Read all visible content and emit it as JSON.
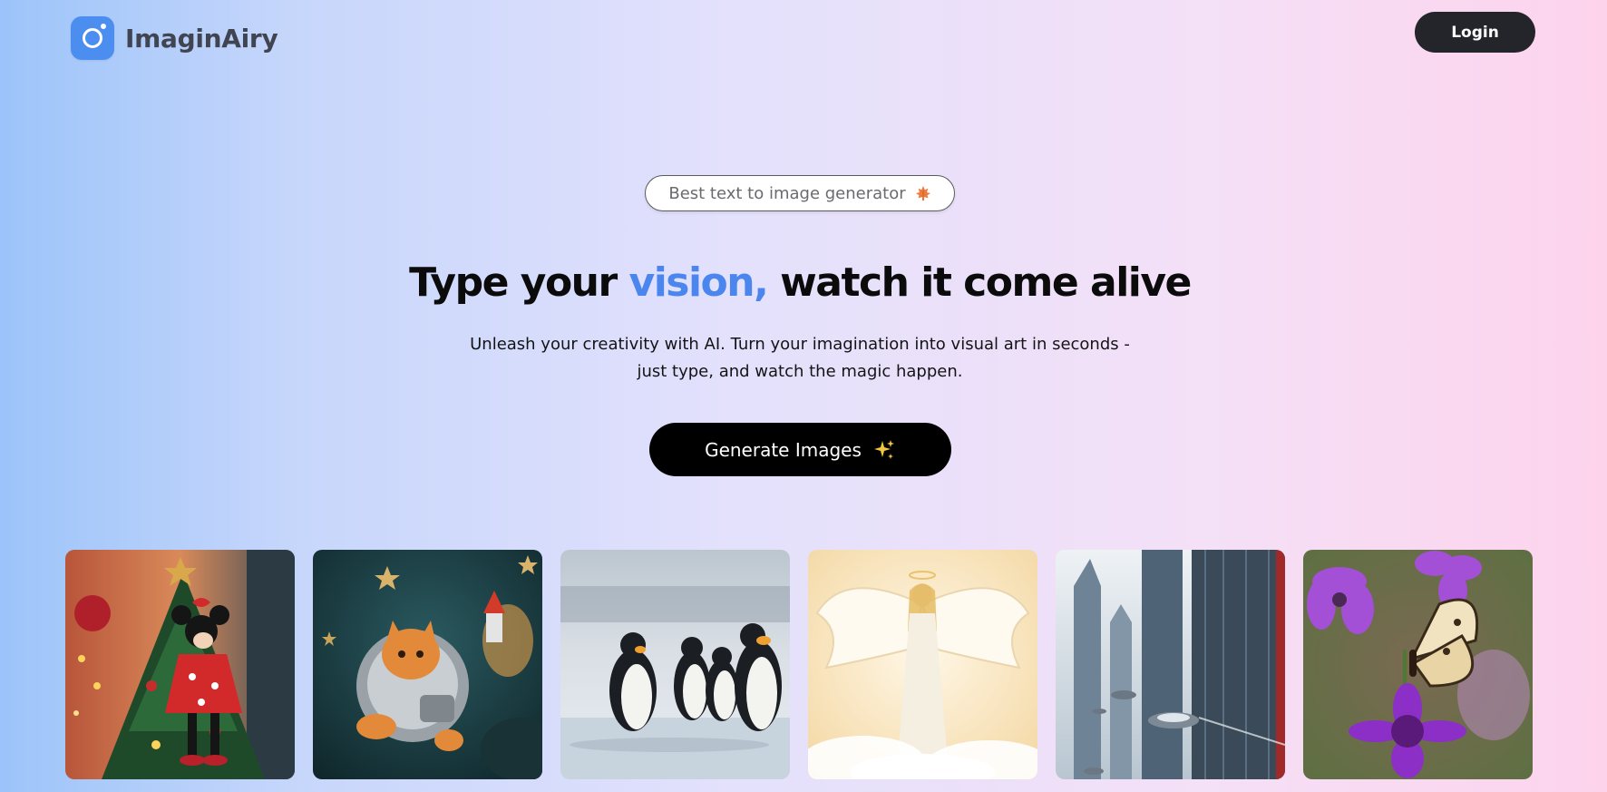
{
  "header": {
    "brand_name": "ImaginAiry",
    "login_label": "Login"
  },
  "hero": {
    "badge_text": "Best text to image generator",
    "headline_part1": "Type your ",
    "headline_accent": "vision,",
    "headline_part2": " watch it come alive",
    "subtitle_line1": "Unleash your creativity with AI. Turn your imagination into visual art in seconds -",
    "subtitle_line2": "just type, and watch the magic happen.",
    "cta_label": "Generate Images"
  },
  "colors": {
    "accent": "#4a86ee",
    "brand_logo": "#4b8ef0",
    "login_button": "#24252a",
    "cta_button": "#000000"
  },
  "gallery": {
    "images": [
      {
        "name": "minnie-christmas-tree-image"
      },
      {
        "name": "astronaut-cat-image"
      },
      {
        "name": "penguins-ice-image"
      },
      {
        "name": "angel-clouds-image"
      },
      {
        "name": "futuristic-city-image"
      },
      {
        "name": "butterfly-flowers-image"
      }
    ]
  },
  "icons": {
    "brand": "camera-lens-icon",
    "badge": "maple-leaf-icon",
    "cta": "sparkles-icon"
  }
}
